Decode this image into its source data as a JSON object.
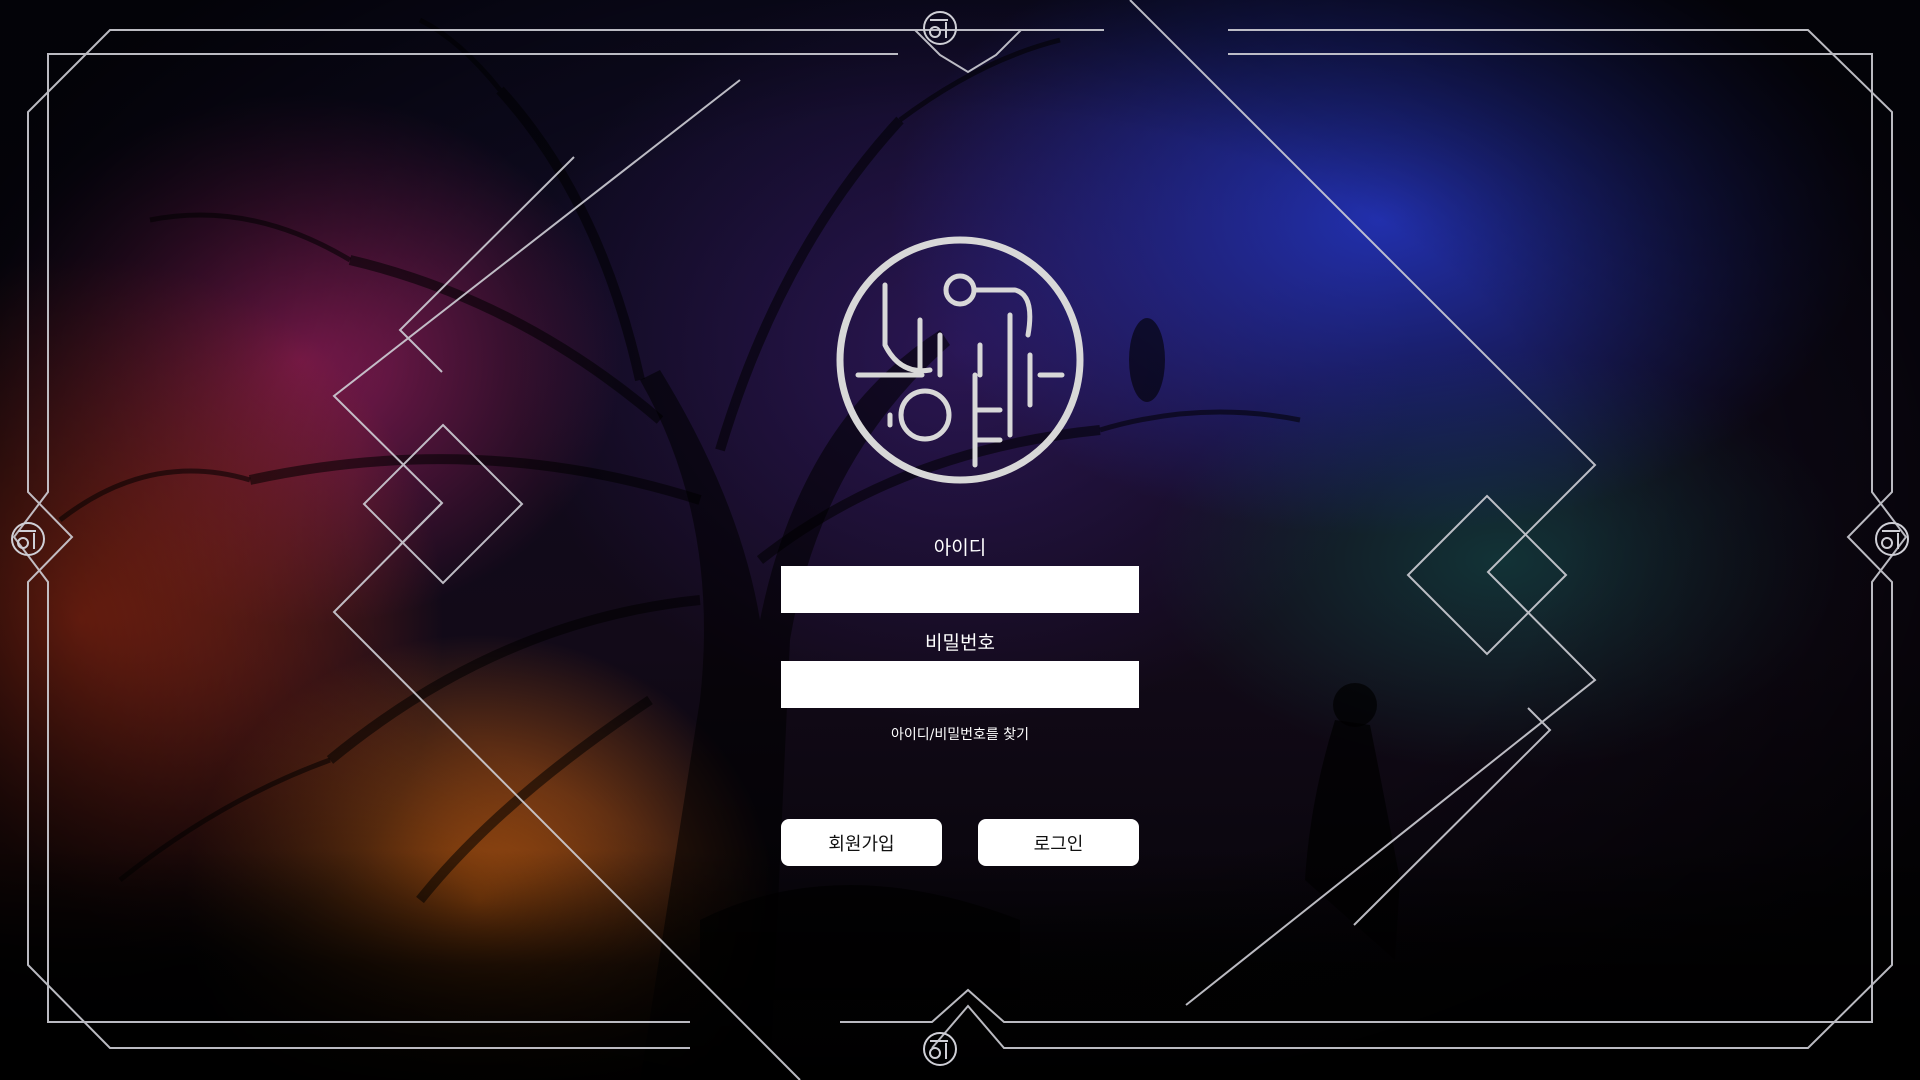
{
  "brand": {
    "logo_icon": "circular-hangul-emblem"
  },
  "login": {
    "id_label": "아이디",
    "id_value": "",
    "password_label": "비밀번호",
    "password_value": "",
    "find_account_link": "아이디/비밀번호를 찾기"
  },
  "actions": {
    "signup_label": "회원가입",
    "login_label": "로그인"
  },
  "colors": {
    "frame_line": "#cfcfd6",
    "button_bg": "#ffffff",
    "text": "#ffffff"
  }
}
